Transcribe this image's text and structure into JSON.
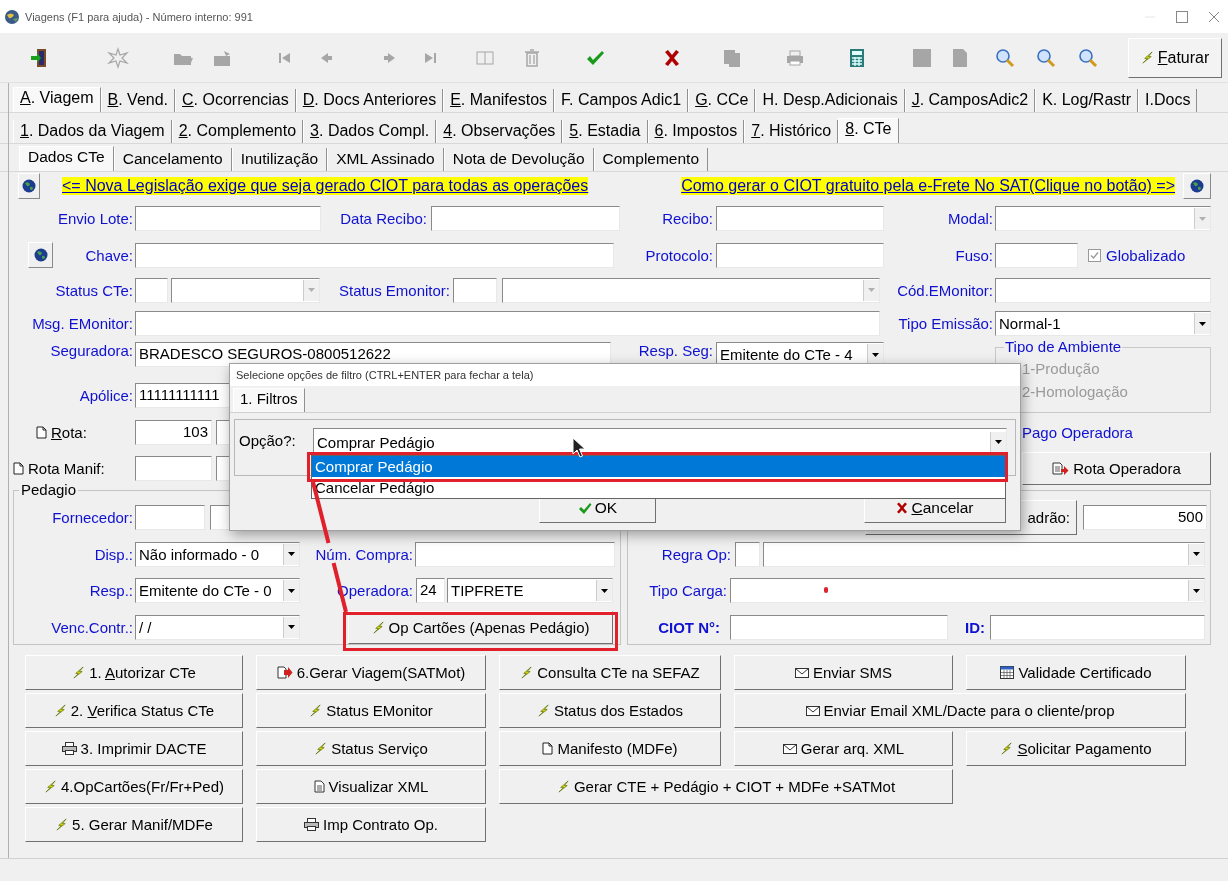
{
  "window": {
    "title": "Viagens (F1 para ajuda) - Número interno: 991"
  },
  "toolbar": [
    {
      "kind": "exit",
      "disabled": false
    },
    {
      "kind": "new",
      "disabled": true
    },
    {
      "kind": "open",
      "disabled": true
    },
    {
      "kind": "save",
      "disabled": true
    },
    {
      "kind": "first",
      "disabled": true
    },
    {
      "kind": "prev",
      "disabled": true
    },
    {
      "kind": "next",
      "disabled": true
    },
    {
      "kind": "last",
      "disabled": true
    },
    {
      "kind": "edit",
      "disabled": true
    },
    {
      "kind": "delete",
      "disabled": true
    },
    {
      "kind": "confirm",
      "disabled": false
    },
    {
      "kind": "cancel",
      "disabled": false
    },
    {
      "kind": "copy",
      "disabled": true
    },
    {
      "kind": "print",
      "disabled": true
    },
    {
      "kind": "calc",
      "disabled": false
    },
    {
      "kind": "square",
      "disabled": true
    },
    {
      "kind": "page",
      "disabled": true
    },
    {
      "kind": "zoom",
      "disabled": false
    },
    {
      "kind": "zoom",
      "disabled": false
    },
    {
      "kind": "zoom",
      "disabled": false
    }
  ],
  "faturar": {
    "label": "Faturar"
  },
  "tabs_main": [
    {
      "label": "A. Viagem",
      "selected": true
    },
    {
      "label": "B. Vend.",
      "selected": false
    },
    {
      "label": "C. Ocorrencias",
      "selected": false
    },
    {
      "label": "D. Docs Anteriores",
      "selected": false
    },
    {
      "label": "E. Manifestos",
      "selected": false
    },
    {
      "label": "F. Campos Adic1",
      "selected": false
    },
    {
      "label": "G. CCe",
      "selected": false
    },
    {
      "label": "H. Desp.Adicionais",
      "selected": false
    },
    {
      "label": "J. CamposAdic2",
      "selected": false
    },
    {
      "label": "K. Log/Rastr",
      "selected": false
    },
    {
      "label": "I.Docs",
      "selected": false
    }
  ],
  "tabs_sub": [
    {
      "label": "1. Dados da Viagem",
      "selected": false
    },
    {
      "label": "2. Complemento",
      "selected": false
    },
    {
      "label": "3. Dados Compl.",
      "selected": false
    },
    {
      "label": "4. Observações",
      "selected": false
    },
    {
      "label": "5. Estadia",
      "selected": false
    },
    {
      "label": "6. Impostos",
      "selected": false
    },
    {
      "label": "7. Histórico",
      "selected": false
    },
    {
      "label": "8. CTe",
      "selected": true
    }
  ],
  "tabs_cte": [
    {
      "label": "Dados CTe",
      "selected": true
    },
    {
      "label": "Cancelamento",
      "selected": false
    },
    {
      "label": "Inutilização",
      "selected": false
    },
    {
      "label": "XML Assinado",
      "selected": false
    },
    {
      "label": "Nota de Devolução",
      "selected": false
    },
    {
      "label": "Complemento",
      "selected": false
    }
  ],
  "form": {
    "rows": [
      {
        "items": [
          {
            "kind": "globe"
          },
          {
            "kind": "link",
            "text": "<= Nova Legislação exige que seja gerado CIOT para todas as operações"
          },
          {
            "kind": "link",
            "text": "Como gerar o CIOT gratuito pela e-Frete No SAT(Clique no botão) =>"
          },
          {
            "kind": "globe"
          }
        ]
      },
      {
        "items": [
          {
            "kind": "label",
            "text": "Envio Lote:"
          },
          {
            "kind": "field"
          },
          {
            "kind": "label",
            "text": "Data Recibo:"
          },
          {
            "kind": "field"
          },
          {
            "kind": "label",
            "text": "Recibo:"
          },
          {
            "kind": "field"
          },
          {
            "kind": "label",
            "text": "Modal:"
          },
          {
            "kind": "combo",
            "disabled": true
          }
        ]
      },
      {
        "items": [
          {
            "kind": "globe"
          },
          {
            "kind": "label",
            "text": "Chave:"
          },
          {
            "kind": "field"
          },
          {
            "kind": "label",
            "text": "Protocolo:"
          },
          {
            "kind": "field"
          },
          {
            "kind": "label",
            "text": "Fuso:"
          },
          {
            "kind": "field"
          },
          {
            "kind": "checkbox",
            "label": "Globalizado",
            "checked": true,
            "disabled": true
          }
        ]
      },
      {
        "items": [
          {
            "kind": "label",
            "text": "Status CTe:"
          },
          {
            "kind": "field"
          },
          {
            "kind": "combo",
            "disabled": true
          },
          {
            "kind": "label",
            "text": "Status Emonitor:"
          },
          {
            "kind": "field"
          },
          {
            "kind": "combo",
            "disabled": true
          },
          {
            "kind": "label",
            "text": "Cód.EMonitor:"
          },
          {
            "kind": "field"
          }
        ]
      },
      {
        "items": [
          {
            "kind": "label",
            "text": "Msg. EMonitor:"
          },
          {
            "kind": "field"
          },
          {
            "kind": "label",
            "text": "Tipo Emissão:"
          },
          {
            "kind": "combo",
            "value": "Normal-1",
            "disabled": false
          }
        ]
      },
      {
        "items": [
          {
            "kind": "label",
            "text": "Seguradora:"
          },
          {
            "kind": "field",
            "value": "BRADESCO SEGUROS-0800512622"
          },
          {
            "kind": "label",
            "text": "Resp. Seg:"
          },
          {
            "kind": "combo",
            "value": "Emitente do CTe - 4",
            "disabled": false
          },
          {
            "kind": "group",
            "title": "Tipo de Ambiente",
            "disabled": true,
            "options": [
              {
                "label": "1-Produção"
              },
              {
                "label": "2-Homologação"
              }
            ]
          }
        ]
      },
      {
        "items": [
          {
            "kind": "label",
            "text": "Apólice:"
          },
          {
            "kind": "field",
            "value": "11111111111"
          }
        ]
      },
      {
        "items": [
          {
            "kind": "label",
            "text": "Rota:"
          },
          {
            "kind": "field",
            "value": "103"
          },
          {
            "kind": "field"
          },
          {
            "kind": "label",
            "text": "Pago Operadora"
          }
        ]
      },
      {
        "items": [
          {
            "kind": "label",
            "text": "Rota Manif:"
          },
          {
            "kind": "field"
          },
          {
            "kind": "field"
          },
          {
            "kind": "button",
            "label": "Rota Operadora"
          }
        ]
      }
    ]
  },
  "pedagio": {
    "title": "Pedagio",
    "rows": [
      {
        "items": [
          {
            "kind": "label",
            "text": "Fornecedor:"
          },
          {
            "kind": "field"
          },
          {
            "kind": "field"
          }
        ]
      },
      {
        "items": [
          {
            "kind": "label",
            "text": "Disp.:"
          },
          {
            "kind": "combo",
            "value": "Não informado - 0",
            "disabled": false
          },
          {
            "kind": "label",
            "text": "Núm. Compra:"
          },
          {
            "kind": "field"
          }
        ]
      },
      {
        "items": [
          {
            "kind": "label",
            "text": "Resp.:"
          },
          {
            "kind": "combo",
            "value": "Emitente do CTe - 0",
            "disabled": false
          },
          {
            "kind": "label",
            "text": "Operadora:"
          },
          {
            "kind": "field",
            "value": "24"
          },
          {
            "kind": "combo",
            "value": "TIPFRETE",
            "disabled": false
          }
        ]
      },
      {
        "items": [
          {
            "kind": "label",
            "text": "Venc.Contr.:"
          },
          {
            "kind": "combo",
            "value": "/ /",
            "disabled": false
          },
          {
            "kind": "button",
            "label": "Op Cartões (Apenas Pedágio)"
          }
        ]
      }
    ]
  },
  "right_panel": {
    "rows": [
      {
        "items": [
          {
            "kind": "button",
            "label": "adrão:"
          },
          {
            "kind": "field",
            "value": "500"
          }
        ]
      },
      {
        "items": [
          {
            "kind": "label",
            "text": "Regra Op:"
          },
          {
            "kind": "field"
          },
          {
            "kind": "combo",
            "disabled": false
          }
        ]
      },
      {
        "items": [
          {
            "kind": "label",
            "text": "Tipo Carga:"
          },
          {
            "kind": "combo",
            "disabled": false
          }
        ]
      },
      {
        "items": [
          {
            "kind": "label",
            "text": "CIOT N°:"
          },
          {
            "kind": "field"
          },
          {
            "kind": "label",
            "text": "ID:"
          },
          {
            "kind": "field"
          }
        ]
      }
    ]
  },
  "actions": [
    {
      "label": "1. Autorizar CTe"
    },
    {
      "label": "6.Gerar Viagem(SATMot)"
    },
    {
      "label": "Consulta CTe na SEFAZ"
    },
    {
      "label": "Enviar SMS"
    },
    {
      "label": "Validade Certificado"
    },
    {
      "label": "2. Verifica Status CTe"
    },
    {
      "label": "Status EMonitor"
    },
    {
      "label": "Status dos Estados"
    },
    {
      "label": "Enviar Email XML/Dacte para o cliente/prop"
    },
    {
      "label": "3. Imprimir DACTE"
    },
    {
      "label": "Status Serviço"
    },
    {
      "label": "Manifesto (MDFe)"
    },
    {
      "label": "Gerar arq. XML"
    },
    {
      "label": "Solicitar Pagamento"
    },
    {
      "label": "4.OpCartões(Fr/Fr+Ped)"
    },
    {
      "label": "Visualizar XML"
    },
    {
      "label": "Gerar CTE + Pedágio + CIOT + MDFe +SATMot"
    },
    {
      "label": "5. Gerar Manif/MDFe"
    },
    {
      "label": "Imp Contrato Op."
    }
  ],
  "dialog": {
    "title": "Selecione opções de filtro (CTRL+ENTER para fechar a tela)",
    "tabs": [
      {
        "label": "1. Filtros",
        "selected": true
      }
    ],
    "option_label": "Opção?:",
    "combo_value": "Comprar Pedágio",
    "options": [
      {
        "label": "Comprar Pedágio",
        "selected": true
      },
      {
        "label": "Cancelar Pedágio",
        "selected": false
      }
    ],
    "ok_button": {
      "label": "OK"
    },
    "cancel_button": {
      "label": "Cancelar"
    }
  }
}
